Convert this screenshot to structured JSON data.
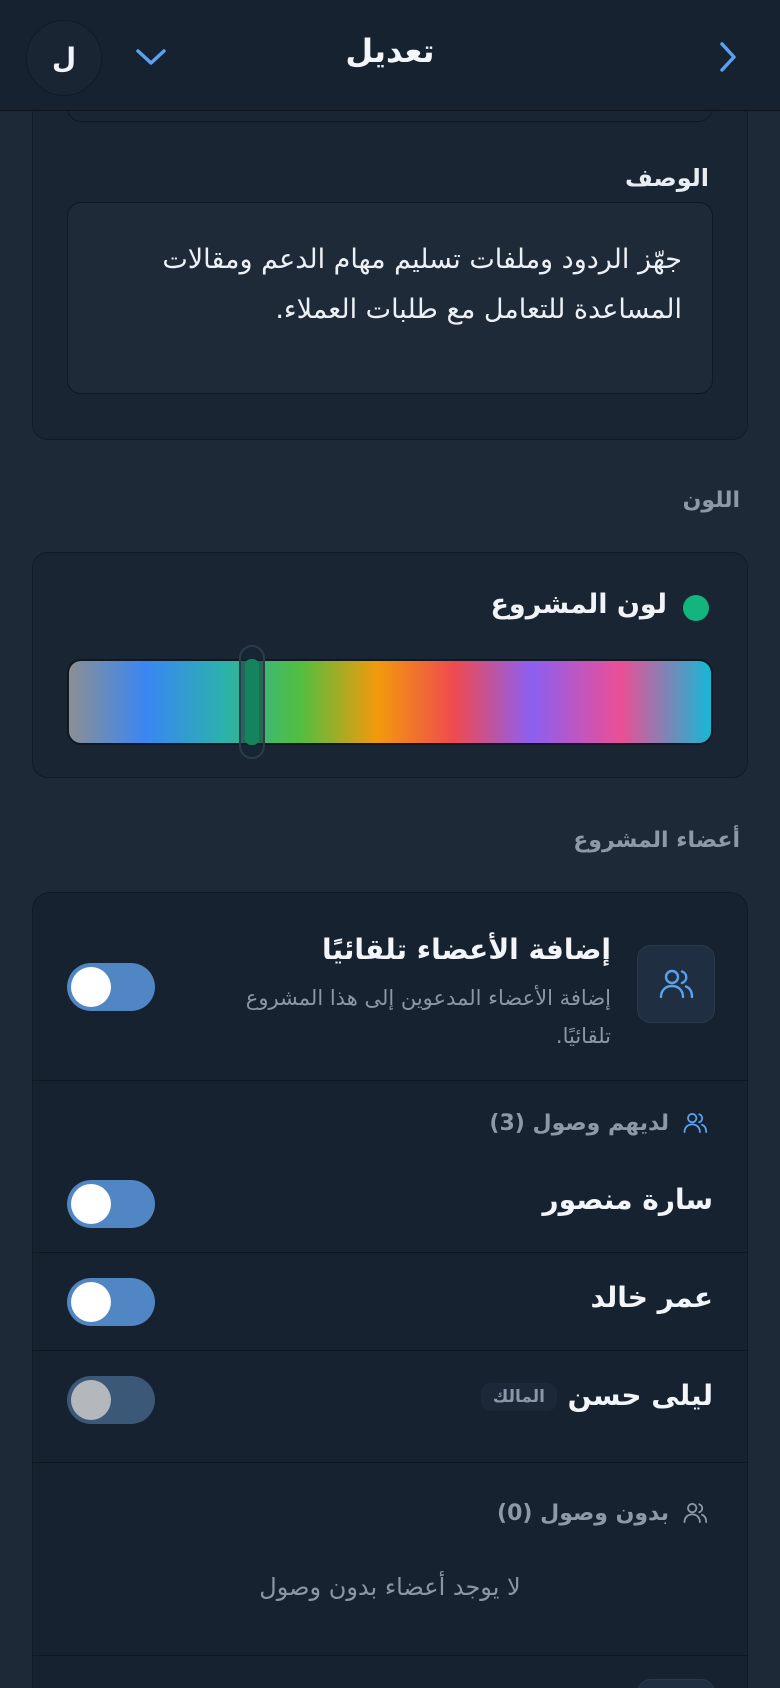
{
  "header": {
    "title": "تعديل",
    "avatar_initial": "ل"
  },
  "form": {
    "description_label": "الوصف",
    "description_value": "جهّز الردود وملفات تسليم مهام الدعم ومقالات المساعدة للتعامل مع طلبات العملاء."
  },
  "color_section": {
    "section_label": "اللون",
    "project_color_label": "لون المشروع",
    "selected_color": "#13b57f",
    "hue_position": 0.27
  },
  "members_section": {
    "section_label": "أعضاء المشروع",
    "auto_add": {
      "title": "إضافة الأعضاء تلقائيًا",
      "subtitle": "إضافة الأعضاء المدعوين إلى هذا المشروع تلقائيًا.",
      "enabled": true
    },
    "with_access": {
      "heading": "لديهم وصول (3)",
      "members": [
        {
          "name": "سارة منصور",
          "access": true
        },
        {
          "name": "عمر خالد",
          "access": true
        },
        {
          "name": "ليلى حسن",
          "badge": "المالك",
          "access": false
        }
      ]
    },
    "without_access": {
      "heading": "بدون وصول (0)",
      "empty_text": "لا يوجد أعضاء بدون وصول"
    }
  }
}
